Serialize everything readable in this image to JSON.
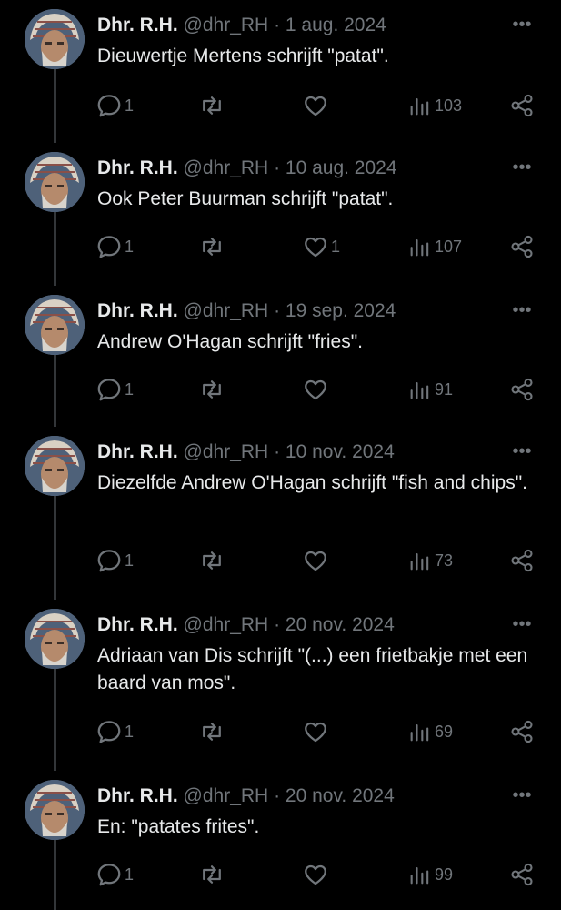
{
  "author": {
    "name": "Dhr. R.H.",
    "handle": "@dhr_RH",
    "separator": "·"
  },
  "icons": [
    "reply-icon",
    "retweet-icon",
    "like-icon",
    "views-icon",
    "share-icon",
    "more-icon",
    "avatar"
  ],
  "colors": {
    "background": "#000000",
    "text": "#e7e9ea",
    "muted": "#71767b",
    "thread_line": "#333639"
  },
  "tweets": [
    {
      "date": "1 aug. 2024",
      "text": "Dieuwertje Mertens schrijft \"patat\".",
      "replies": "1",
      "likes": "",
      "views": "103"
    },
    {
      "date": "10 aug. 2024",
      "text": "Ook Peter Buurman schrijft \"patat\".",
      "replies": "1",
      "likes": "1",
      "views": "107"
    },
    {
      "date": "19 sep. 2024",
      "text": "Andrew O'Hagan schrijft \"fries\".",
      "replies": "1",
      "likes": "",
      "views": "91"
    },
    {
      "date": "10 nov. 2024",
      "text": "Diezelfde Andrew O'Hagan schrijft \"fish and chips\".",
      "replies": "1",
      "likes": "",
      "views": "73"
    },
    {
      "date": "20 nov. 2024",
      "text": "Adriaan van Dis schrijft \"(...) een frietbakje met een baard van mos\".",
      "replies": "1",
      "likes": "",
      "views": "69"
    },
    {
      "date": "20 nov. 2024",
      "text": "En: \"patates frites\".",
      "replies": "1",
      "likes": "",
      "views": "99"
    }
  ]
}
